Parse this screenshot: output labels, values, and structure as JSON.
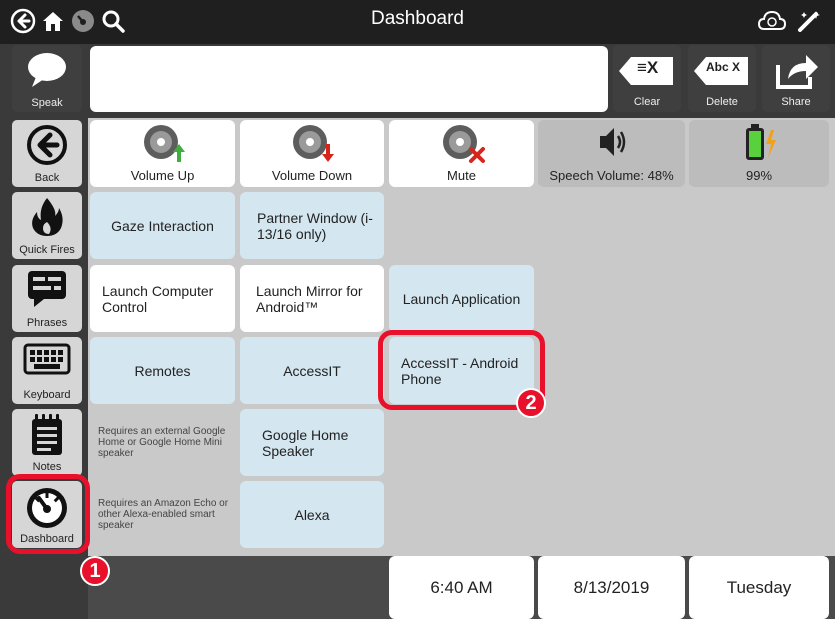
{
  "topbar": {
    "title": "Dashboard",
    "left_icons": [
      "back-circle-icon",
      "home-icon",
      "dashboard-gauge-icon",
      "search-icon"
    ],
    "right_icons": [
      "cloud-sync-icon",
      "edit-wand-icon"
    ]
  },
  "message_bar": {
    "speak_label": "Speak",
    "clear_label": "Clear",
    "clear_icon_text": "≡X",
    "delete_label": "Delete",
    "delete_icon_text": "Abc X",
    "share_label": "Share"
  },
  "sidebar": {
    "items": [
      {
        "label": "Back",
        "icon": "back-arrow-icon"
      },
      {
        "label": "Quick Fires",
        "icon": "flame-icon"
      },
      {
        "label": "Phrases",
        "icon": "chat-lines-icon"
      },
      {
        "label": "Keyboard",
        "icon": "keyboard-icon"
      },
      {
        "label": "Notes",
        "icon": "notepad-icon"
      },
      {
        "label": "Dashboard",
        "icon": "dashboard-gauge-icon"
      }
    ]
  },
  "grid": {
    "volume_up": "Volume Up",
    "volume_down": "Volume Down",
    "mute": "Mute",
    "speech_volume": "Speech Volume: 48%",
    "battery": "99%",
    "gaze": "Gaze Interaction",
    "partner_window": "Partner Window (i-13/16 only)",
    "launch_computer_control": "Launch Computer Control",
    "launch_mirror": "Launch Mirror for Android™",
    "launch_application": "Launch Application",
    "remotes": "Remotes",
    "accessit": "AccessIT",
    "accessit_android": "AccessIT - Android Phone",
    "google_note": "Requires an external Google Home or Google Home Mini speaker",
    "google_home": "Google Home Speaker",
    "alexa_note": "Requires an Amazon Echo or other Alexa-enabled smart speaker",
    "alexa": "Alexa",
    "time": "6:40 AM",
    "date": "8/13/2019",
    "day": "Tuesday"
  },
  "annotations": {
    "badge_1": "1",
    "badge_2": "2",
    "highlight_color": "#e8102a"
  },
  "colors": {
    "topbar": "#1f1f1f",
    "panel": "#3a3a3a",
    "cell_blue": "#d4e6ef",
    "cell_white": "#ffffff",
    "background": "#c9c9c9"
  }
}
